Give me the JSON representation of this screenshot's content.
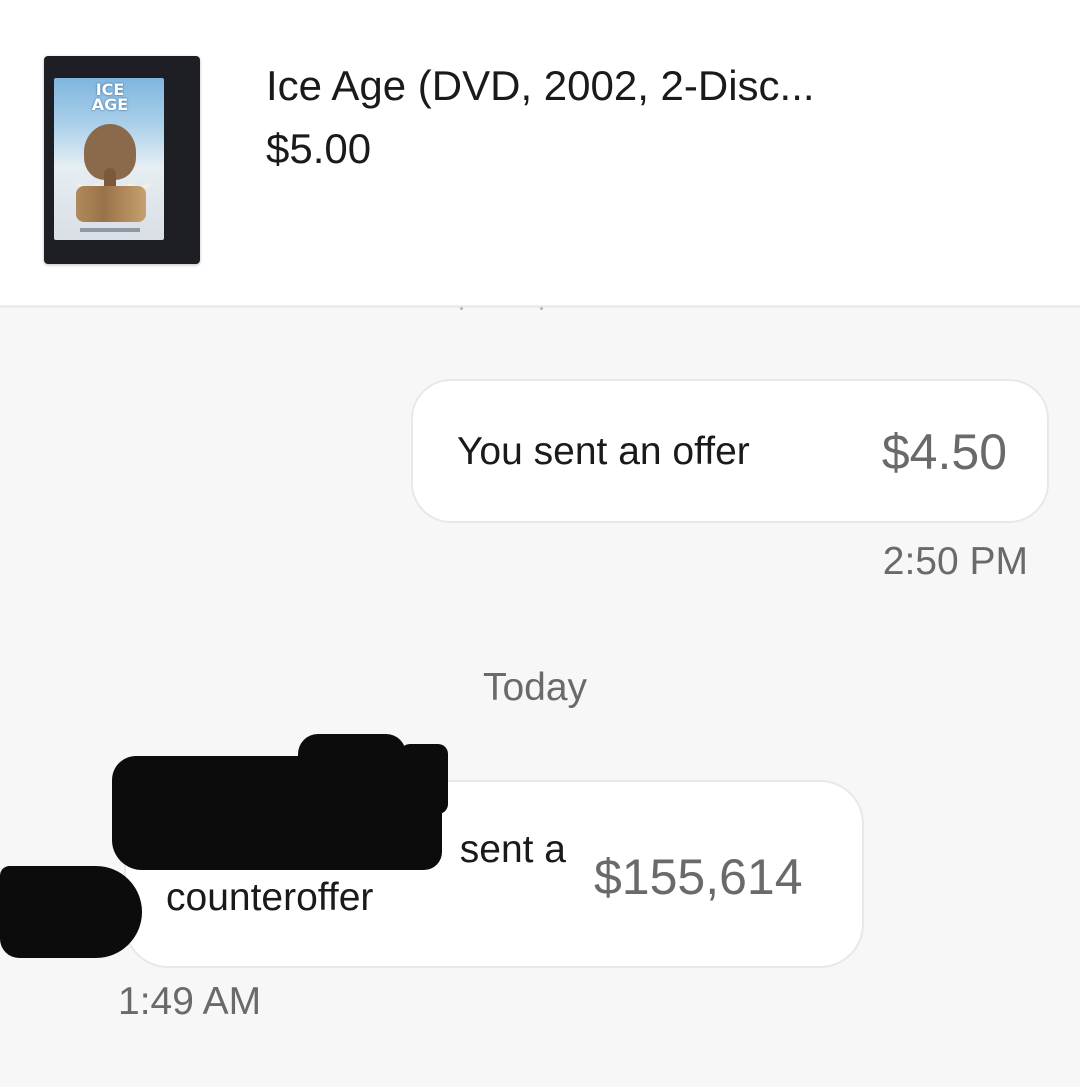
{
  "listing": {
    "title": "Ice Age (DVD, 2002, 2-Disc...",
    "price": "$5.00",
    "thumbnail_icon": "dvd-cover-image",
    "thumbnail_text": "ICE AGE"
  },
  "messages": [
    {
      "direction": "sent",
      "label": "You sent an offer",
      "amount": "$4.50",
      "time": "2:50 PM"
    },
    {
      "direction": "received",
      "label_line1": "sent a",
      "label_line2": "counteroffer",
      "amount": "$155,614",
      "time": "1:49 AM",
      "sender_redacted": true
    }
  ],
  "day_separator": "Today",
  "colors": {
    "background": "#f7f7f7",
    "bubble": "#ffffff",
    "primary_text": "#1a1a1a",
    "muted_text": "#6a6a6a",
    "redaction": "#0c0c0c"
  }
}
